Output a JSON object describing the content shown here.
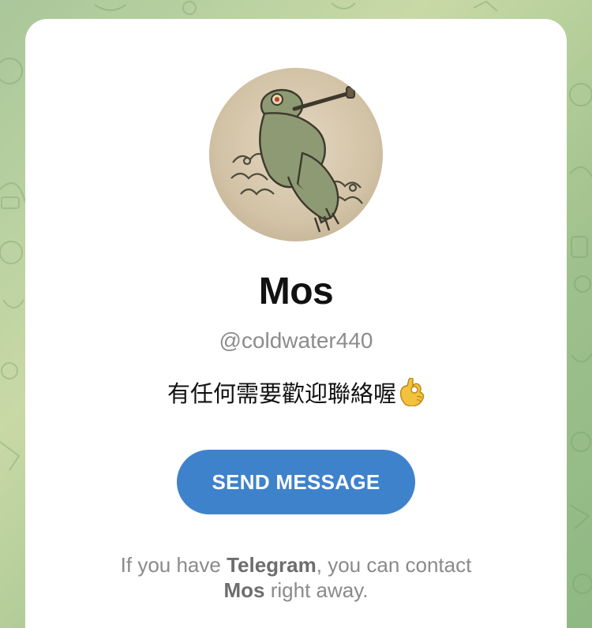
{
  "profile": {
    "name": "Mos",
    "username": "@coldwater440",
    "bio_text": "有任何需要歡迎聯絡喔",
    "bio_emoji": "ok-hand-emoji",
    "avatar_icon": "frog-avatar"
  },
  "actions": {
    "send_message_label": "SEND MESSAGE"
  },
  "footer": {
    "part1": "If you have ",
    "app_name": "Telegram",
    "part2": ", you can contact",
    "contact_name": "Mos",
    "part3": " right away."
  },
  "colors": {
    "button": "#3f82cc",
    "background": "#a9c79a",
    "card": "#ffffff"
  }
}
